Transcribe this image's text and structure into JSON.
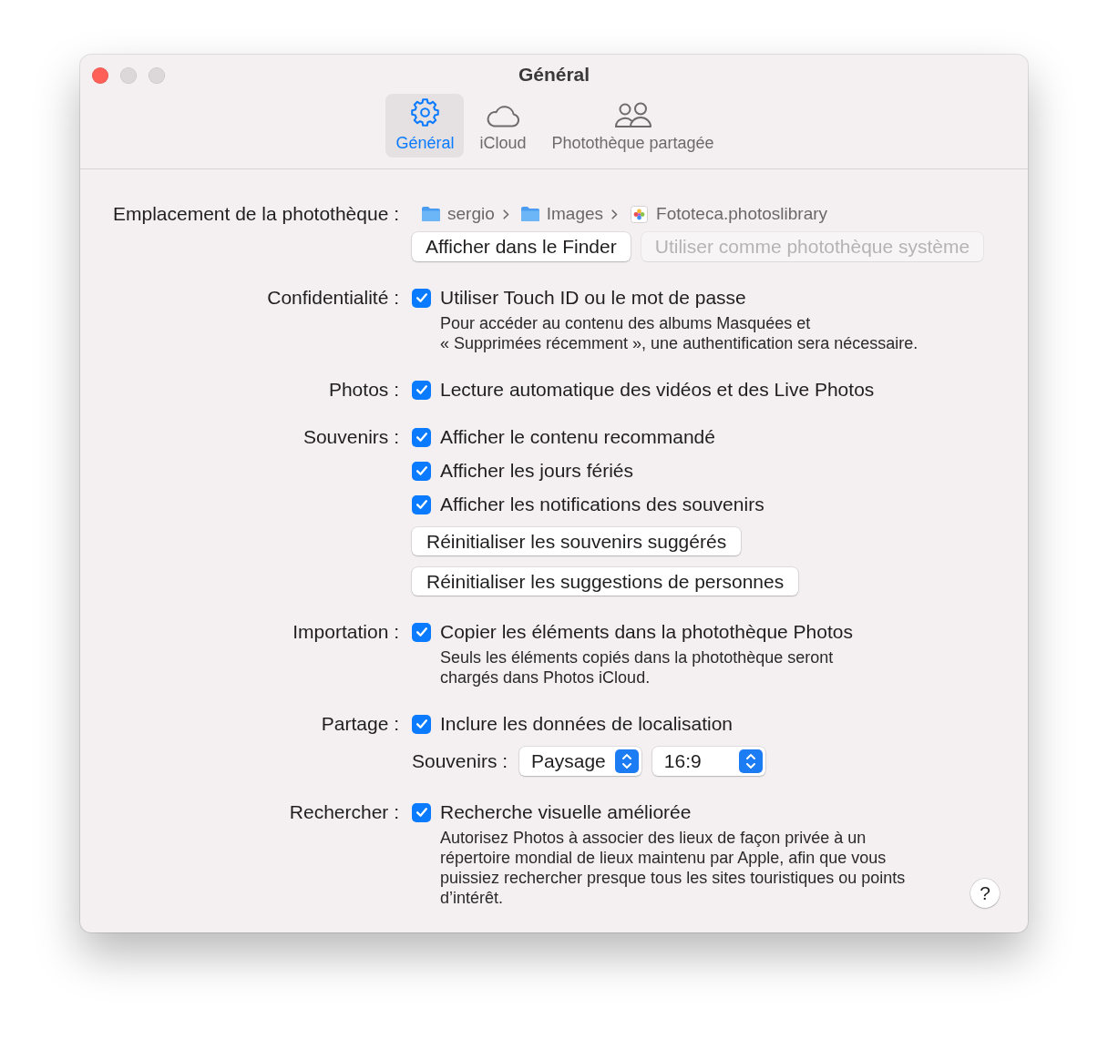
{
  "window": {
    "title": "Général"
  },
  "tabs": [
    {
      "label": "Général",
      "selected": true
    },
    {
      "label": "iCloud",
      "selected": false
    },
    {
      "label": "Photothèque partagée",
      "selected": false
    }
  ],
  "library_location": {
    "label": "Emplacement de la photothèque :",
    "path": [
      {
        "name": "sergio",
        "kind": "folder"
      },
      {
        "name": "Images",
        "kind": "folder"
      },
      {
        "name": "Fototeca.photoslibrary",
        "kind": "library"
      }
    ],
    "buttons": [
      {
        "label": "Afficher dans le Finder",
        "disabled": false
      },
      {
        "label": "Utiliser comme photothèque système",
        "disabled": true
      }
    ]
  },
  "sections": [
    {
      "label": "Confidentialité :",
      "items": [
        {
          "kind": "checkbox",
          "label": "Utiliser Touch ID ou le mot de passe",
          "checked": true,
          "note": [
            "Pour accéder au contenu des albums Masquées et",
            "« Supprimées récemment », une authentification sera nécessaire."
          ]
        }
      ]
    },
    {
      "label": "Photos :",
      "items": [
        {
          "kind": "checkbox",
          "label": "Lecture automatique des vidéos et des Live Photos",
          "checked": true
        }
      ]
    },
    {
      "label": "Souvenirs :",
      "items": [
        {
          "kind": "checkbox",
          "label": "Afficher le contenu recommandé",
          "checked": true
        },
        {
          "kind": "checkbox",
          "label": "Afficher les jours fériés",
          "checked": true
        },
        {
          "kind": "checkbox",
          "label": "Afficher les notifications des souvenirs",
          "checked": true
        },
        {
          "kind": "button",
          "label": "Réinitialiser les souvenirs suggérés"
        },
        {
          "kind": "button",
          "label": "Réinitialiser les suggestions de personnes"
        }
      ]
    },
    {
      "label": "Importation :",
      "items": [
        {
          "kind": "checkbox",
          "label": "Copier les éléments dans la photothèque Photos",
          "checked": true,
          "note": [
            "Seuls les éléments copiés dans la photothèque seront",
            "chargés dans Photos iCloud."
          ]
        }
      ]
    },
    {
      "label": "Partage :",
      "items": [
        {
          "kind": "checkbox",
          "label": "Inclure les données de localisation",
          "checked": true
        },
        {
          "kind": "popups",
          "label": "Souvenirs :",
          "popups": [
            {
              "value": "Paysage"
            },
            {
              "value": "16:9"
            }
          ]
        }
      ]
    },
    {
      "label": "Rechercher :",
      "items": [
        {
          "kind": "checkbox",
          "label": "Recherche visuelle améliorée",
          "checked": true,
          "note": [
            "Autorisez Photos à associer des lieux de façon privée à un",
            "répertoire mondial de lieux maintenu par Apple, afin que vous",
            "puissiez rechercher presque tous les sites touristiques ou points",
            "d’intérêt."
          ]
        }
      ]
    }
  ],
  "help_button": {
    "label": "?"
  }
}
